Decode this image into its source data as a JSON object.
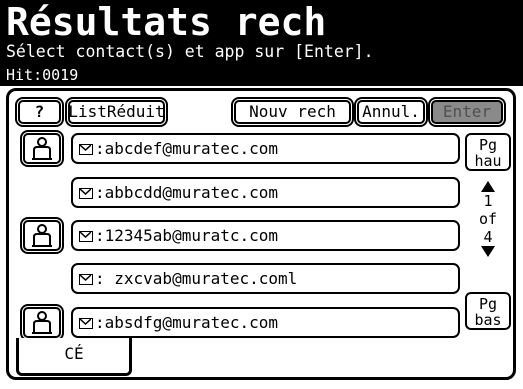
{
  "header": {
    "title": "Résultats rech",
    "subtitle": "Sélect contact(s) et app sur [Enter].",
    "hit": "Hit:0019"
  },
  "toolbar": {
    "help_label": "?",
    "list_reduced_label": "ListRéduit",
    "new_search_label": "Nouv rech",
    "cancel_label": "Annul.",
    "enter_label": "Enter"
  },
  "contacts": [
    {
      "email": ":abcdef@muratec.com",
      "has_person_icon": true
    },
    {
      "email": ":abbcdd@muratec.com",
      "has_person_icon": false
    },
    {
      "email": ":12345ab@muratc.com",
      "has_person_icon": true
    },
    {
      "email": ": zxcvab@muratec.coml",
      "has_person_icon": false
    },
    {
      "email": ":absdfg@muratec.com",
      "has_person_icon": true
    }
  ],
  "pager": {
    "page_up": "Pg\nhau",
    "page_down": "Pg\nbas",
    "current": "1",
    "of_label": "of",
    "total": "4"
  },
  "tabs": [
    {
      "label": "CÉ"
    }
  ]
}
